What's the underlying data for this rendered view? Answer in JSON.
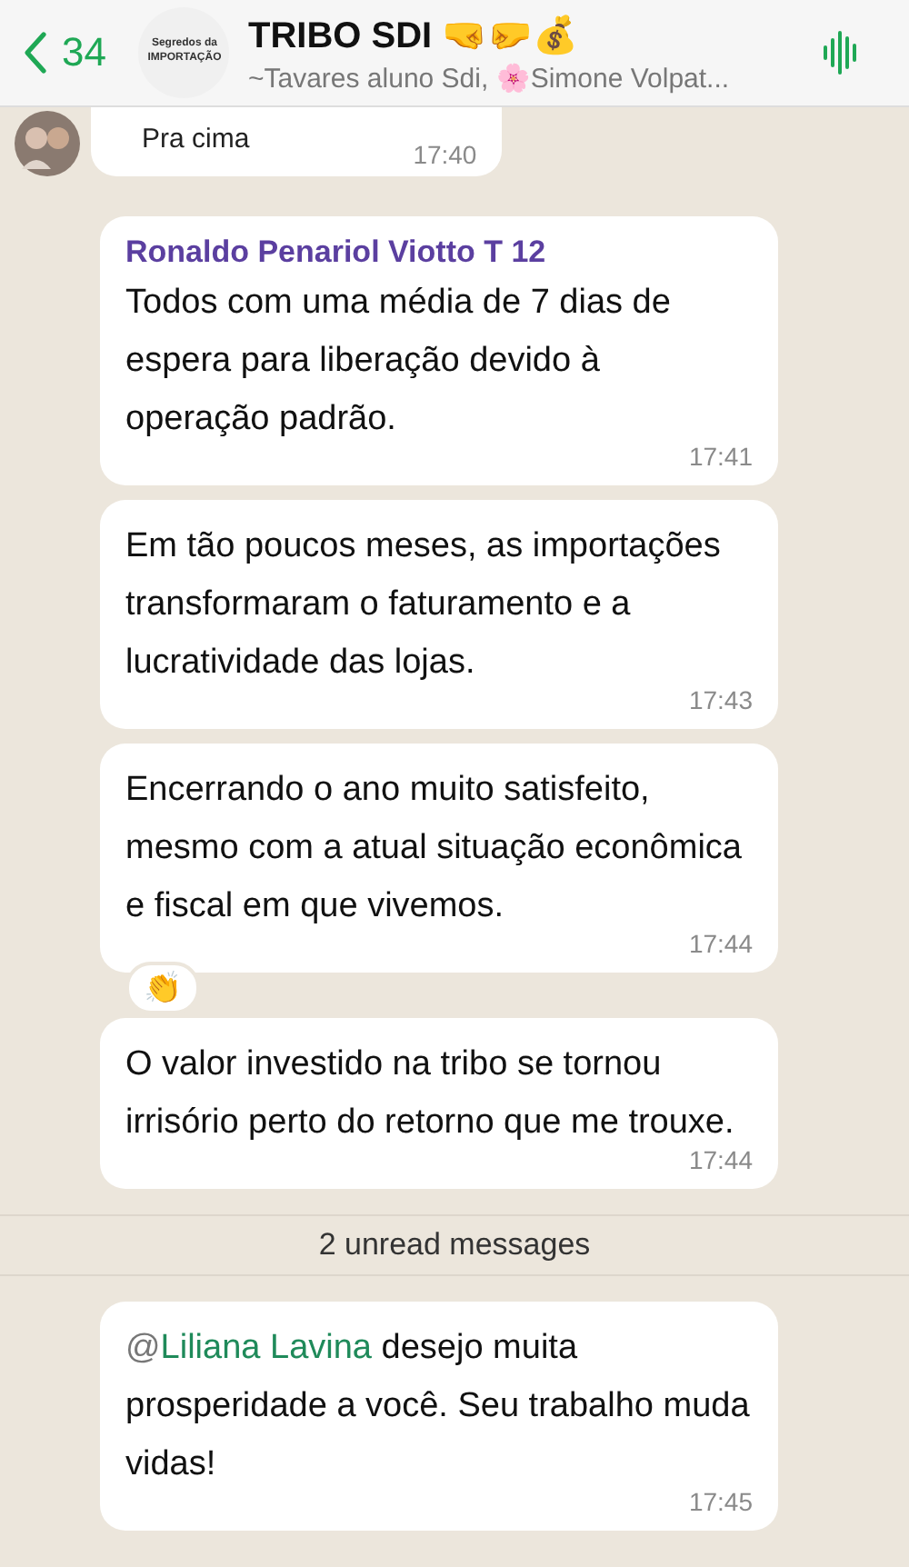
{
  "header": {
    "back_count": "34",
    "avatar_text": "Segredos da IMPORTAÇÃO",
    "title": "TRIBO SDI 🤜🤛💰",
    "subtitle": "~Tavares aluno Sdi, 🌸Simone Volpat..."
  },
  "messages": [
    {
      "kind": "partial",
      "text": "Pra cima",
      "time": "17:40"
    },
    {
      "kind": "text",
      "sender": "Ronaldo Penariol Viotto T 12",
      "text": "Todos com uma média de 7 dias de espera para liberação devido à operação padrão.",
      "time": "17:41"
    },
    {
      "kind": "text",
      "text": "Em tão poucos meses, as importações transformaram o faturamento e a lucratividade das lojas.",
      "time": "17:43"
    },
    {
      "kind": "text",
      "text": "Encerrando o ano muito satisfeito, mesmo com a atual situação econômica e fiscal em que vivemos.",
      "time": "17:44",
      "reaction": "👏"
    },
    {
      "kind": "text",
      "text": "O valor investido na tribo se tornou irrisório perto do retorno que me trouxe.",
      "time": "17:44"
    },
    {
      "kind": "divider",
      "text": "2 unread messages"
    },
    {
      "kind": "mention",
      "mention_prefix": "@",
      "mention": "Liliana Lavina",
      "text": " desejo muita prosperidade a você. Seu trabalho muda vidas!",
      "time": "17:45"
    }
  ]
}
